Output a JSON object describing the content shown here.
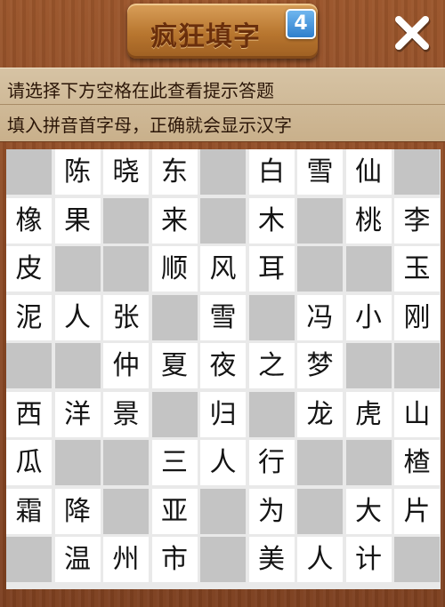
{
  "header": {
    "title": "疯狂填字",
    "level_badge": "4",
    "close_icon": "close-x-icon"
  },
  "hints": {
    "line1": "请选择下方空格在此查看提示答题",
    "line2": "填入拼音首字母，正确就会显示汉字"
  },
  "colors": {
    "wood": "#8a4a24",
    "plate": "#c4873f",
    "title_text": "#6a2f0c",
    "badge": "#3f8fd9",
    "hint_bg": "#d6c3a4",
    "cell_white": "#ffffff",
    "cell_gray": "#c4c4c4"
  },
  "grid": {
    "rows": 9,
    "cols": 9,
    "cells": [
      [
        "#",
        "陈",
        "晓",
        "东",
        "#",
        "白",
        "雪",
        "仙",
        "#"
      ],
      [
        "橡",
        "果",
        "#",
        "来",
        "#",
        "木",
        "#",
        "桃",
        "李"
      ],
      [
        "皮",
        "#",
        "#",
        "顺",
        "风",
        "耳",
        "#",
        "#",
        "玉"
      ],
      [
        "泥",
        "人",
        "张",
        "#",
        "雪",
        "#",
        "冯",
        "小",
        "刚"
      ],
      [
        "#",
        "#",
        "仲",
        "夏",
        "夜",
        "之",
        "梦",
        "#",
        "#"
      ],
      [
        "西",
        "洋",
        "景",
        "#",
        "归",
        "#",
        "龙",
        "虎",
        "山"
      ],
      [
        "瓜",
        "#",
        "#",
        "三",
        "人",
        "行",
        "#",
        "#",
        "楂"
      ],
      [
        "霜",
        "降",
        "#",
        "亚",
        "#",
        "为",
        "#",
        "大",
        "片"
      ],
      [
        "#",
        "温",
        "州",
        "市",
        "#",
        "美",
        "人",
        "计",
        "#"
      ]
    ]
  }
}
